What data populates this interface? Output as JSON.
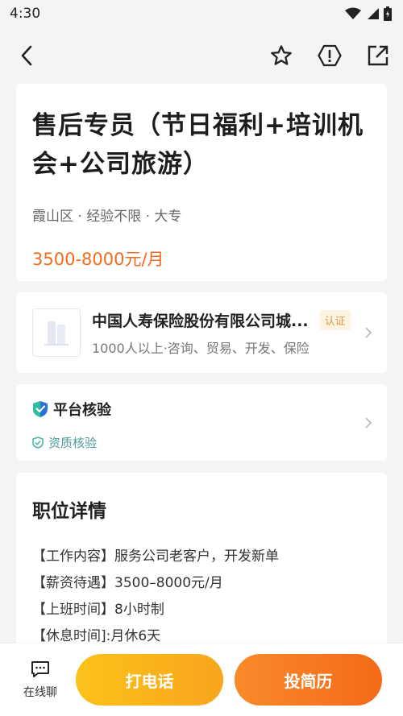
{
  "status_bar": {
    "time": "4:30",
    "icons": [
      "wifi-icon",
      "signal-icon",
      "battery-icon"
    ]
  },
  "toolbar": {
    "back_icon": "back-arrow-icon",
    "actions": [
      "star-icon",
      "report-icon",
      "share-icon"
    ]
  },
  "job": {
    "title": "售后专员（节日福利+培训机会+公司旅游）",
    "meta": "霞山区 · 经验不限 ·  大专",
    "salary": "3500-8000元/月"
  },
  "company": {
    "name": "中国人寿保险股份有限公司城...",
    "badge": "认证",
    "description": "1000人以上·咨询、贸易、开发、保险"
  },
  "verification": {
    "title": "平台核验",
    "subtitle": "资质核验"
  },
  "details": {
    "title": "职位详情",
    "lines": [
      "【工作内容】服务公司老客户，开发新单",
      "【薪资待遇】3500–8000元/月",
      "【上班时间】8小时制",
      "【休息时间]:月休6天"
    ]
  },
  "bottom_bar": {
    "chat_label": "在线聊",
    "call_label": "打电话",
    "apply_label": "投简历"
  },
  "colors": {
    "accent": "#f26b1d",
    "call_gradient": [
      "#fcc21a",
      "#f8a51c"
    ],
    "apply_gradient": [
      "#f88a2b",
      "#f46a18"
    ],
    "verify_green": "#4a9b9e",
    "verify_blue": "#2a72d6",
    "badge_bg": "#fcf3e3",
    "badge_text": "#d89a48"
  }
}
